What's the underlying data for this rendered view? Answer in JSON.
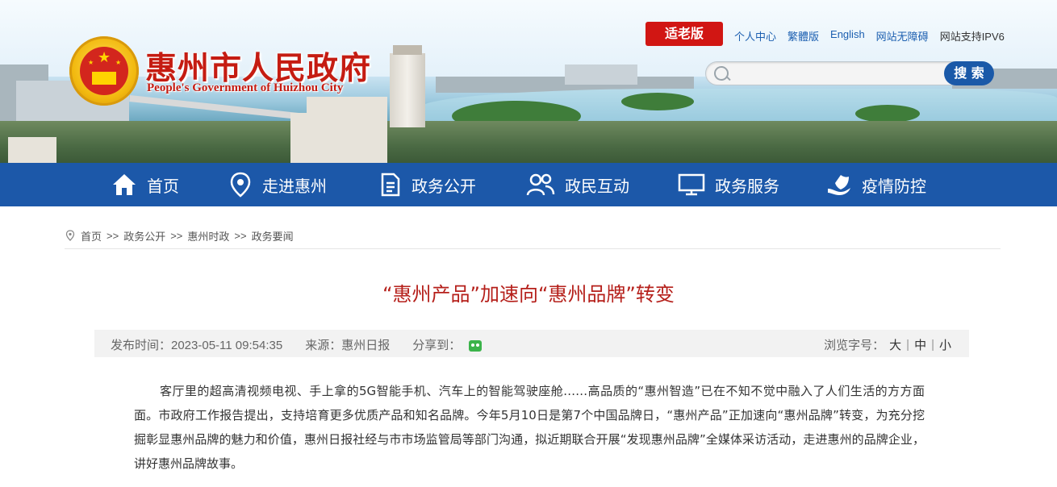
{
  "header": {
    "site_title": "惠州市人民政府",
    "site_subtitle": "People's Government of Huizhou City",
    "elder_version_label": "适老版",
    "top_links": [
      "个人中心",
      "繁體版",
      "English",
      "网站无障碍"
    ],
    "ipv6_text": "网站支持IPV6",
    "search": {
      "placeholder": "",
      "button_label": "搜 索"
    }
  },
  "nav": {
    "items": [
      {
        "label": "首页",
        "icon": "home-icon"
      },
      {
        "label": "走进惠州",
        "icon": "location-pin-icon"
      },
      {
        "label": "政务公开",
        "icon": "document-icon"
      },
      {
        "label": "政民互动",
        "icon": "people-icon"
      },
      {
        "label": "政务服务",
        "icon": "monitor-icon"
      },
      {
        "label": "疫情防控",
        "icon": "shield-hand-icon"
      }
    ]
  },
  "breadcrumb": {
    "items": [
      "首页",
      "政务公开",
      "惠州时政",
      "政务要闻"
    ],
    "separator": ">>"
  },
  "article": {
    "title": "“惠州产品”加速向“惠州品牌”转变",
    "publish_label": "发布时间：2023-05-11 09:54:35",
    "source_label": "来源：惠州日报",
    "share_label": "分享到：",
    "font_size_label": "浏览字号：",
    "font_sizes": [
      "大",
      "中",
      "小"
    ],
    "paragraph": "客厅里的超高清视频电视、手上拿的5G智能手机、汽车上的智能驾驶座舱……高品质的“惠州智造”已在不知不觉中融入了人们生活的方方面面。市政府工作报告提出，支持培育更多优质产品和知名品牌。今年5月10日是第7个中国品牌日，“惠州产品”正加速向“惠州品牌”转变，为充分挖掘彰显惠州品牌的魅力和价值，惠州日报社经与市市场监管局等部门沟通，拟近期联合开展“发现惠州品牌”全媒体采访活动，走进惠州的品牌企业，讲好惠州品牌故事。"
  },
  "colors": {
    "nav_bg": "#1c58a9",
    "title_red": "#b51f1a",
    "elder_button": "#d11613",
    "link_blue": "#1c5fb0"
  }
}
